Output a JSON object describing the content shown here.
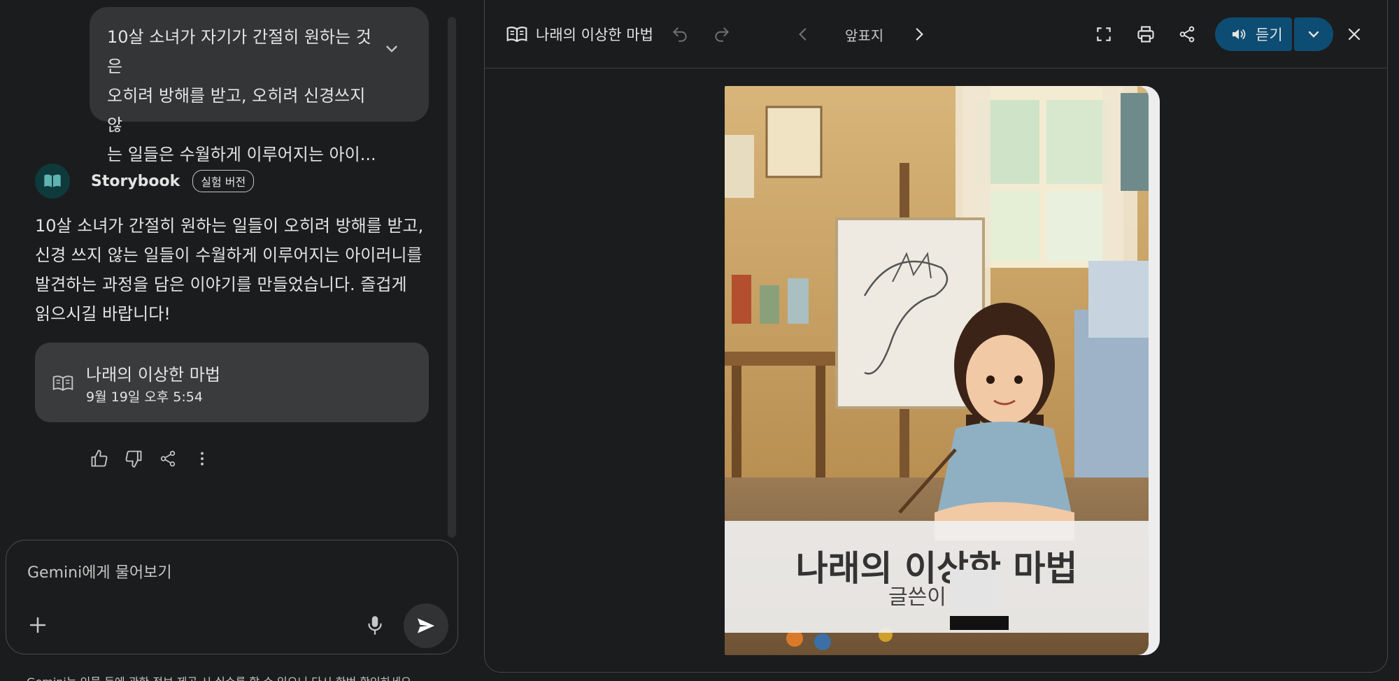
{
  "chat": {
    "user_prompt_lines": [
      "10살 소녀가 자기가 간절히 원하는 것은",
      "오히려 방해를 받고, 오히려 신경쓰지 않",
      "는 일들은 수월하게 이루어지는 아이..."
    ],
    "bot_name": "Storybook",
    "bot_badge": "실험 버전",
    "bot_message": "10살 소녀가 간절히 원하는 일들이 오히려 방해를 받고, 신경 쓰지 않는 일들이 수월하게 이루어지는 아이러니를 발견하는 과정을 담은 이야기를 만들었습니다. 즐겁게 읽으시길 바랍니다!",
    "story_card": {
      "title": "나래의 이상한 마법",
      "date": "9월 19일 오후 5:54"
    },
    "actions": [
      "thumbs-up-icon",
      "thumbs-down-icon",
      "share-icon",
      "more-vert-icon"
    ],
    "input_placeholder": "Gemini에게 물어보기",
    "disclaimer": "Gemini는 인물 등에 관한 정보 제공 시 실수를 할 수 있으니 다시 한번 확인하세요."
  },
  "viewer": {
    "title": "나래의 이상한 마법",
    "page_label": "앞표지",
    "listen_label": "듣기",
    "cover_title": "나래의 이상한 마법",
    "cover_author_prefix": "글쓴이"
  },
  "colors": {
    "background": "#1b1c1d",
    "bubble": "#333537",
    "card": "#3a3b3d",
    "accent": "#0e4d73"
  }
}
